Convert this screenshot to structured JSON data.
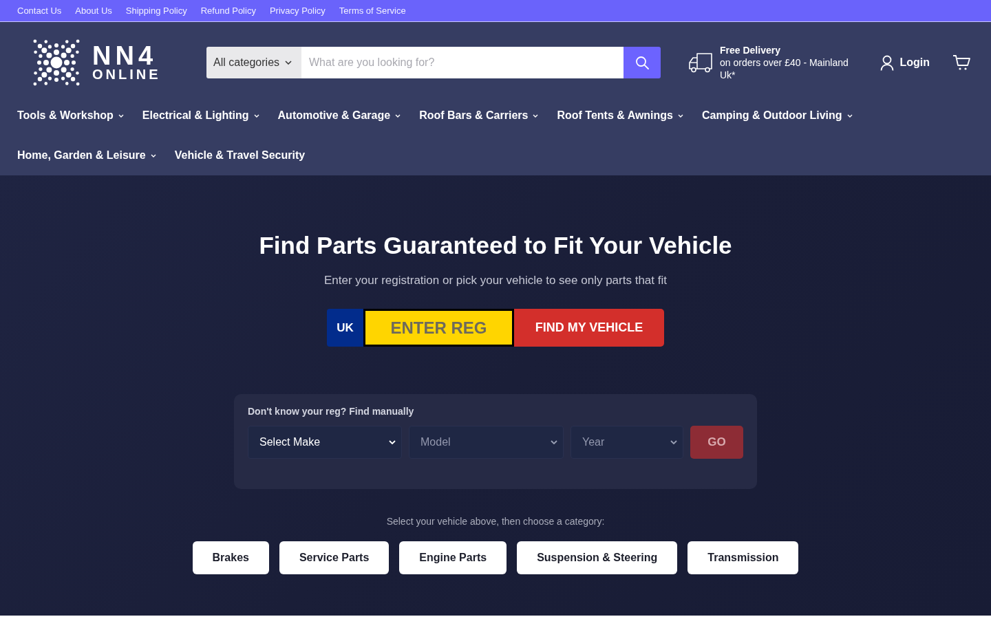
{
  "top_links": [
    "Contact Us",
    "About Us",
    "Shipping Policy",
    "Refund Policy",
    "Privacy Policy",
    "Terms of Service"
  ],
  "header": {
    "logo": {
      "line_1": "NN4",
      "line_2": "ONLINE"
    },
    "search": {
      "category": "All categories",
      "placeholder": "What are you looking for?"
    },
    "delivery": {
      "title": "Free Delivery",
      "text": "on orders over £40 - Mainland Uk*"
    },
    "login": "Login"
  },
  "nav": [
    {
      "label": "Tools & Workshop",
      "has_menu": true
    },
    {
      "label": "Electrical & Lighting",
      "has_menu": true
    },
    {
      "label": "Automotive & Garage",
      "has_menu": true
    },
    {
      "label": "Roof Bars & Carriers",
      "has_menu": true
    },
    {
      "label": "Roof Tents & Awnings",
      "has_menu": true
    },
    {
      "label": "Camping & Outdoor Living",
      "has_menu": true
    },
    {
      "label": "Home, Garden & Leisure",
      "has_menu": true
    },
    {
      "label": "Vehicle & Travel Security",
      "has_menu": false
    }
  ],
  "hero": {
    "title": "Find Parts Guaranteed to Fit Your Vehicle",
    "subtitle": "Enter your registration or pick your vehicle to see only parts that fit",
    "reg": {
      "country": "UK",
      "placeholder": "ENTER REG",
      "button": "FIND MY VEHICLE"
    },
    "manual": {
      "label": "Don't know your reg? Find manually",
      "selects": [
        {
          "value": "Select Make",
          "disabled": false
        },
        {
          "value": "Model",
          "disabled": true
        },
        {
          "value": "Year",
          "disabled": true
        }
      ],
      "go": {
        "label": "GO",
        "disabled": true
      }
    },
    "category_hint": "Select your vehicle above, then choose a category:",
    "categories": [
      "Brakes",
      "Service Parts",
      "Engine Parts",
      "Suspension & Steering",
      "Transmission"
    ]
  }
}
